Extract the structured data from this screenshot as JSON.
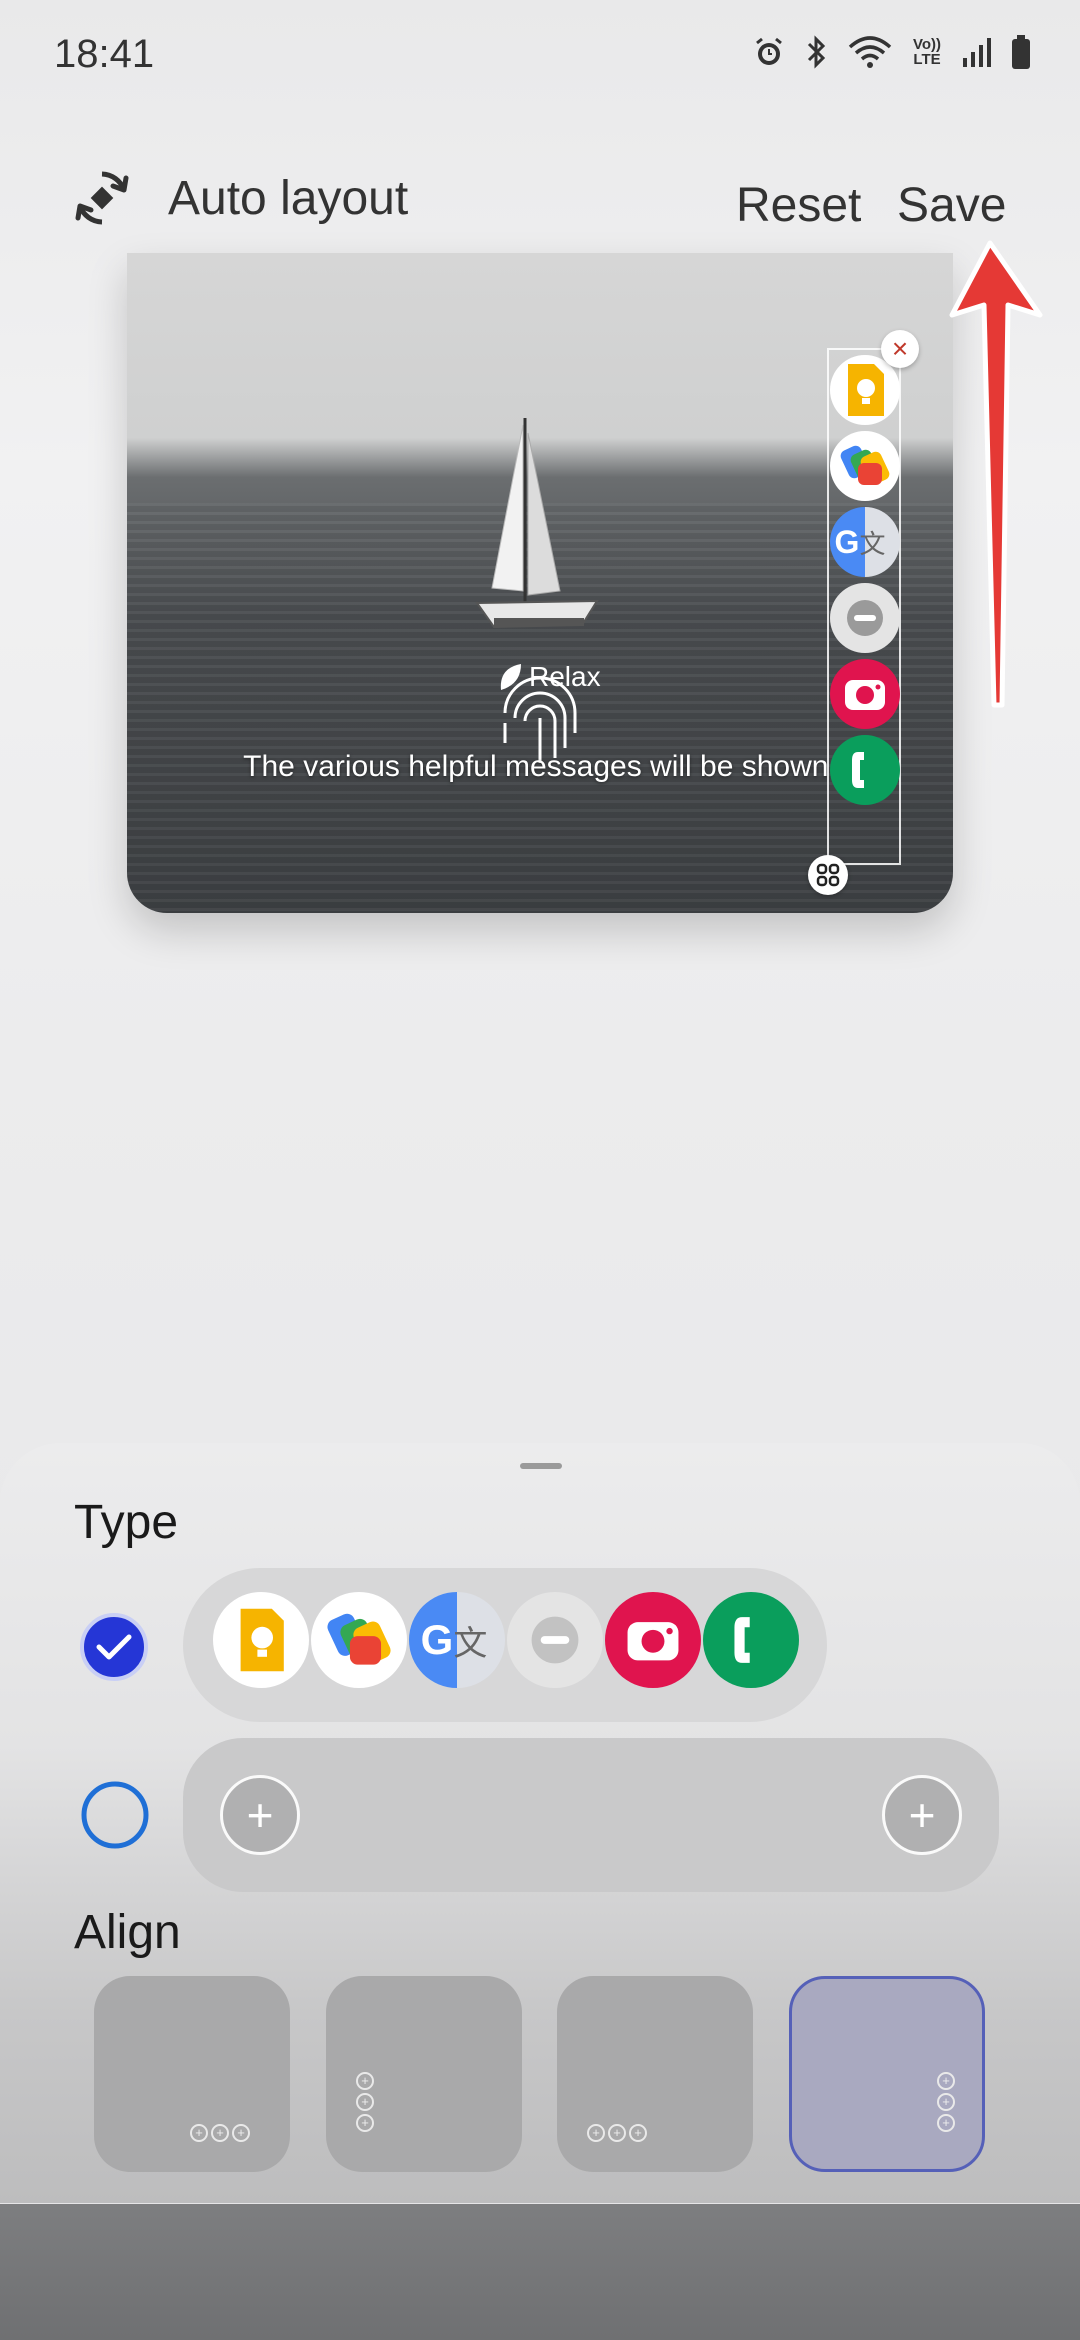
{
  "status_bar": {
    "time": "18:41",
    "icons": [
      "alarm-icon",
      "bluetooth-icon",
      "wifi-icon",
      "volte-icon",
      "signal-icon",
      "battery-icon"
    ],
    "volte_text": "Vo)) LTE"
  },
  "header": {
    "auto_layout_label": "Auto layout",
    "reset_label": "Reset",
    "save_label": "Save"
  },
  "preview": {
    "relax_label": "Relax",
    "message": "The various helpful messages will be shown.",
    "strip_icons": [
      "keep-notes-icon",
      "google-wallet-icon",
      "google-translate-icon",
      "do-not-disturb-icon",
      "camera-icon",
      "phone-icon"
    ]
  },
  "sheet": {
    "type_title": "Type",
    "type_options": [
      {
        "selected": true,
        "icons": [
          "keep-notes-icon",
          "google-wallet-icon",
          "google-translate-icon",
          "do-not-disturb-icon",
          "camera-icon",
          "phone-icon"
        ]
      },
      {
        "selected": false,
        "icons": [
          "add-icon",
          "add-icon"
        ]
      }
    ],
    "align_title": "Align",
    "align_options": [
      "bottom-horizontal",
      "left-vertical",
      "bottom-horizontal",
      "right-vertical"
    ],
    "align_selected_index": 3
  },
  "colors": {
    "accent": "#2536d6",
    "arrow": "#e53935",
    "selected_border": "#5560b8"
  }
}
